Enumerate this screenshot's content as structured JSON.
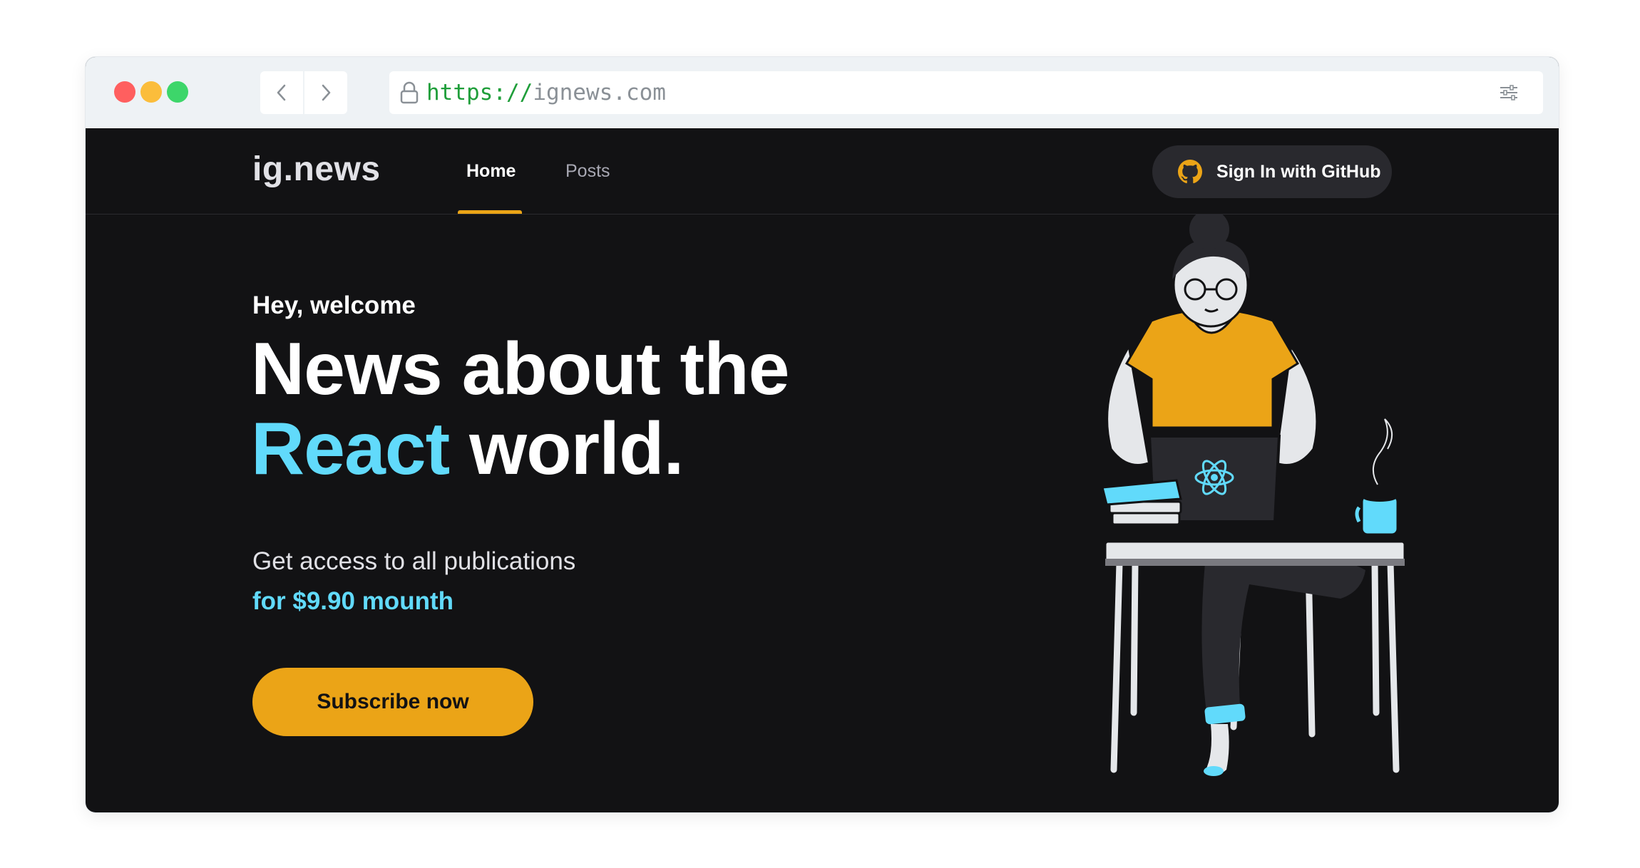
{
  "browser": {
    "url_scheme": "https://",
    "url_host": "ignews.com"
  },
  "header": {
    "logo": "ig.news",
    "nav": [
      {
        "label": "Home",
        "active": true
      },
      {
        "label": "Posts",
        "active": false
      }
    ],
    "signin_label": "Sign In with GitHub"
  },
  "hero": {
    "greeting": "Hey, welcome",
    "title_line1": "News about the",
    "title_accent": "React",
    "title_rest": "world.",
    "subtitle": "Get access to all publications",
    "price": "for $9.90 mounth",
    "cta": "Subscribe now"
  },
  "colors": {
    "background": "#121214",
    "accent_yellow": "#eba417",
    "accent_cyan": "#61dafb"
  },
  "icons": [
    "lock-icon",
    "chevron-left-icon",
    "chevron-right-icon",
    "sliders-icon",
    "github-icon"
  ]
}
